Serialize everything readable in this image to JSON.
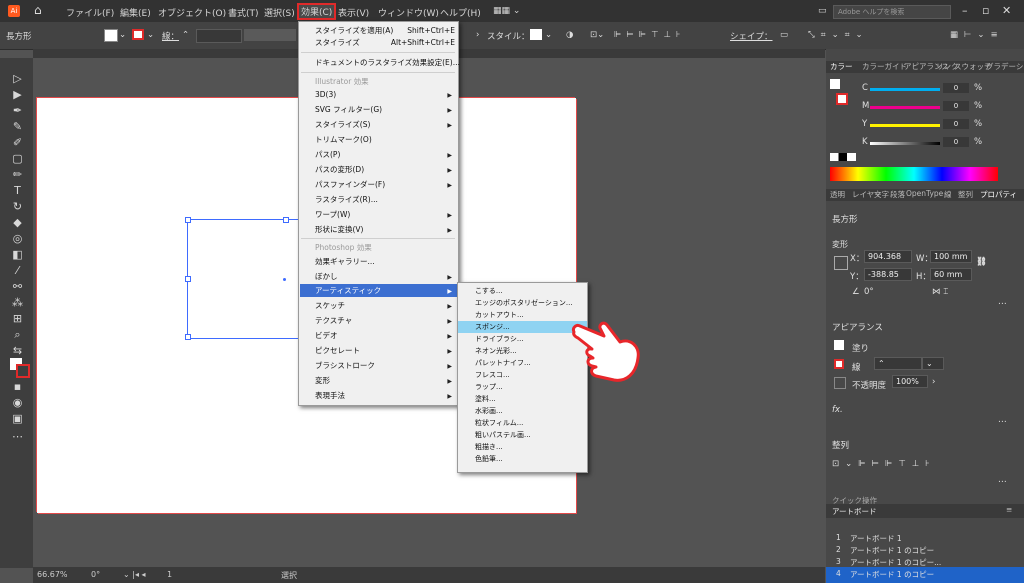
{
  "menubar": {
    "logo": "Ai",
    "items": [
      "ファイル(F)",
      "編集(E)",
      "オブジェクト(O)",
      "書式(T)",
      "選択(S)",
      "効果(C)",
      "表示(V)",
      "ウィンドウ(W)",
      "ヘルプ(H)"
    ],
    "search_placeholder": "Adobe ヘルプを検索"
  },
  "control_bar": {
    "object_type": "長方形",
    "stroke_label": "線：",
    "style_label": "スタイル：",
    "shape_label": "シェイプ："
  },
  "effect_menu": {
    "top_items": [
      {
        "label": "スタイライズを適用(A)",
        "shortcut": "Shift+Ctrl+E"
      },
      {
        "label": "スタイライズ",
        "shortcut": "Alt+Shift+Ctrl+E"
      }
    ],
    "doc_raster": "ドキュメントのラスタライズ効果設定(E)...",
    "illustrator_header": "Illustrator 効果",
    "illustrator_items": [
      "3D(3)",
      "SVG フィルター(G)",
      "スタイライズ(S)",
      "トリムマーク(O)",
      "パス(P)",
      "パスの変形(D)",
      "パスファインダー(F)",
      "ラスタライズ(R)...",
      "ワープ(W)",
      "形状に変換(V)"
    ],
    "photoshop_header": "Photoshop 効果",
    "photoshop_items": [
      "効果ギャラリー...",
      "ぼかし",
      "アーティスティック",
      "スケッチ",
      "テクスチャ",
      "ビデオ",
      "ピクセレート",
      "ブラシストローク",
      "変形",
      "表現手法"
    ],
    "highlighted": "アーティスティック"
  },
  "submenu": {
    "items": [
      "こする...",
      "エッジのポスタリゼーション...",
      "カットアウト...",
      "スポンジ...",
      "ドライブラシ...",
      "ネオン光彩...",
      "パレットナイフ...",
      "フレスコ...",
      "ラップ...",
      "塗料...",
      "水彩画...",
      "粒状フィルム...",
      "粗いパステル画...",
      "粗描き...",
      "色鉛筆..."
    ],
    "highlighted": "スポンジ..."
  },
  "right_panel": {
    "color_tabs": [
      "カラー",
      "カラーガイド",
      "アピアランス",
      "リンク",
      "スウォッチ",
      "グラデーション"
    ],
    "channels": [
      {
        "label": "C",
        "value": "0",
        "unit": "%",
        "color": "#00aeef"
      },
      {
        "label": "M",
        "value": "0",
        "unit": "%",
        "color": "#ec008c"
      },
      {
        "label": "Y",
        "value": "0",
        "unit": "%",
        "color": "#fff200"
      },
      {
        "label": "K",
        "value": "0",
        "unit": "%",
        "color": "#cccccc"
      }
    ],
    "prop_tabs": [
      "透明",
      "レイヤー",
      "文字",
      "段落",
      "OpenType",
      "線",
      "整列",
      "プロパティ"
    ],
    "object_name": "長方形",
    "transform_header": "変形",
    "x_label": "X：",
    "x_value": "904.368",
    "y_label": "Y：",
    "y_value": "-388.85",
    "w_label": "W：",
    "w_value": "100 mm",
    "h_label": "H：",
    "h_value": "60 mm",
    "angle": "0°",
    "appearance_header": "アピアランス",
    "fill_label": "塗り",
    "stroke_label": "線",
    "opacity_label": "不透明度",
    "opacity_value": "100%",
    "fx_label": "fx.",
    "align_header": "整列",
    "quick_actions": "クイック操作",
    "artboard_tab": "アートボード",
    "artboards": [
      {
        "num": "1",
        "name": "アートボード 1"
      },
      {
        "num": "2",
        "name": "アートボード 1 のコピー"
      },
      {
        "num": "3",
        "name": "アートボード 1 のコピー..."
      },
      {
        "num": "4",
        "name": "アートボード 1 のコピー"
      }
    ]
  },
  "status_bar": {
    "zoom": "66.67%",
    "rotation": "0°",
    "page": "1",
    "mode": "選択"
  }
}
